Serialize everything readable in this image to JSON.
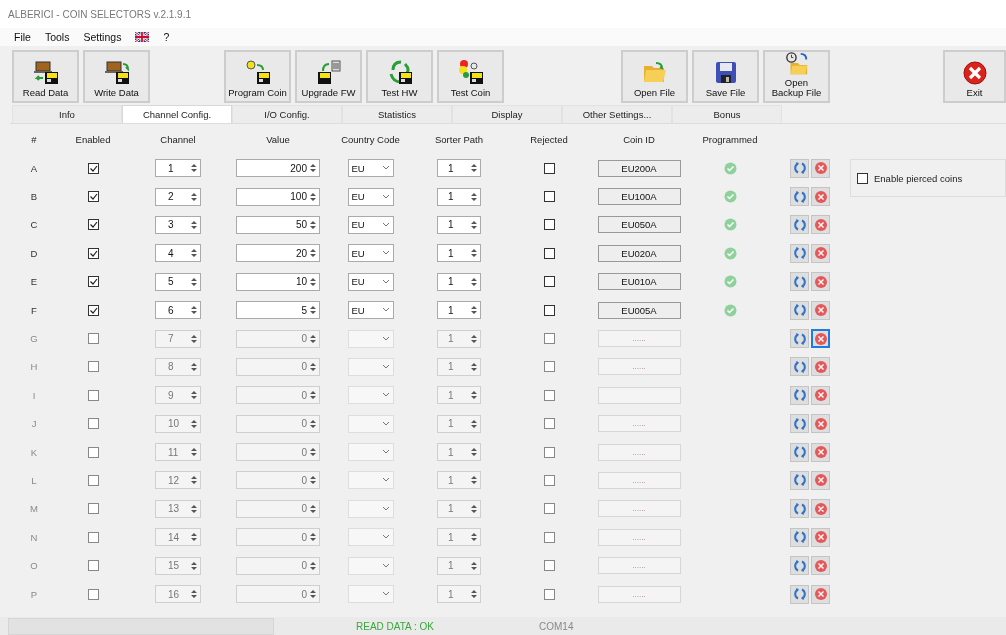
{
  "window": {
    "title": "ALBERICI - COIN SELECTORS v.2.1.9.1"
  },
  "menu": [
    {
      "kind": "text",
      "label": "File"
    },
    {
      "kind": "text",
      "label": "Tools"
    },
    {
      "kind": "text",
      "label": "Settings"
    },
    {
      "kind": "flag"
    },
    {
      "kind": "text",
      "label": "?"
    }
  ],
  "toolbar_groups": [
    [
      {
        "label": "Read Data"
      },
      {
        "label": "Write Data"
      }
    ],
    [
      {
        "label": "Program Coin"
      },
      {
        "label": "Upgrade FW"
      },
      {
        "label": "Test HW"
      },
      {
        "label": "Test Coin"
      }
    ],
    [
      {
        "label": "Open File"
      },
      {
        "label": "Save File"
      },
      {
        "label": "Open\nBackup File"
      }
    ],
    [
      {
        "label": "Exit"
      }
    ]
  ],
  "tabs": [
    {
      "label": "Info",
      "selected": false
    },
    {
      "label": "Channel Config.",
      "selected": true
    },
    {
      "label": "I/O Config.",
      "selected": false
    },
    {
      "label": "Statistics",
      "selected": false
    },
    {
      "label": "Display",
      "selected": false
    },
    {
      "label": "Other Settings...",
      "selected": false
    },
    {
      "label": "Bonus",
      "selected": false
    }
  ],
  "table": {
    "columns": [
      "#",
      "Enabled",
      "Channel",
      "Value",
      "Country Code",
      "Sorter Path",
      "Rejected",
      "Coin ID",
      "Programmed"
    ],
    "rows": [
      {
        "id": "A",
        "enabled": true,
        "channel": "1",
        "value": "200",
        "country": "EU",
        "sorter_path": "1",
        "rejected": false,
        "coin_id": "EU200A",
        "programmed": true,
        "disabled": false,
        "delete_focused": false
      },
      {
        "id": "B",
        "enabled": true,
        "channel": "2",
        "value": "100",
        "country": "EU",
        "sorter_path": "1",
        "rejected": false,
        "coin_id": "EU100A",
        "programmed": true,
        "disabled": false,
        "delete_focused": false
      },
      {
        "id": "C",
        "enabled": true,
        "channel": "3",
        "value": "50",
        "country": "EU",
        "sorter_path": "1",
        "rejected": false,
        "coin_id": "EU050A",
        "programmed": true,
        "disabled": false,
        "delete_focused": false
      },
      {
        "id": "D",
        "enabled": true,
        "channel": "4",
        "value": "20",
        "country": "EU",
        "sorter_path": "1",
        "rejected": false,
        "coin_id": "EU020A",
        "programmed": true,
        "disabled": false,
        "delete_focused": false
      },
      {
        "id": "E",
        "enabled": true,
        "channel": "5",
        "value": "10",
        "country": "EU",
        "sorter_path": "1",
        "rejected": false,
        "coin_id": "EU010A",
        "programmed": true,
        "disabled": false,
        "delete_focused": false
      },
      {
        "id": "F",
        "enabled": true,
        "channel": "6",
        "value": "5",
        "country": "EU",
        "sorter_path": "1",
        "rejected": false,
        "coin_id": "EU005A",
        "programmed": true,
        "disabled": false,
        "delete_focused": false
      },
      {
        "id": "G",
        "enabled": false,
        "channel": "7",
        "value": "0",
        "sorter_path": "1",
        "rejected": false,
        "coin_id": "......",
        "programmed": false,
        "disabled": true,
        "delete_focused": true
      },
      {
        "id": "H",
        "enabled": false,
        "channel": "8",
        "value": "0",
        "sorter_path": "1",
        "rejected": false,
        "coin_id": "......",
        "programmed": false,
        "disabled": true,
        "delete_focused": false
      },
      {
        "id": "I",
        "enabled": false,
        "channel": "9",
        "value": "0",
        "sorter_path": "1",
        "rejected": false,
        "programmed": false,
        "disabled": true,
        "delete_focused": false
      },
      {
        "id": "J",
        "enabled": false,
        "channel": "10",
        "value": "0",
        "sorter_path": "1",
        "rejected": false,
        "coin_id": "......",
        "programmed": false,
        "disabled": true,
        "delete_focused": false
      },
      {
        "id": "K",
        "enabled": false,
        "channel": "11",
        "value": "0",
        "sorter_path": "1",
        "rejected": false,
        "coin_id": "......",
        "programmed": false,
        "disabled": true,
        "delete_focused": false
      },
      {
        "id": "L",
        "enabled": false,
        "channel": "12",
        "value": "0",
        "sorter_path": "1",
        "rejected": false,
        "coin_id": "......",
        "programmed": false,
        "disabled": true,
        "delete_focused": false
      },
      {
        "id": "M",
        "enabled": false,
        "channel": "13",
        "value": "0",
        "sorter_path": "1",
        "rejected": false,
        "coin_id": "......",
        "programmed": false,
        "disabled": true,
        "delete_focused": false
      },
      {
        "id": "N",
        "enabled": false,
        "channel": "14",
        "value": "0",
        "sorter_path": "1",
        "rejected": false,
        "coin_id": "......",
        "programmed": false,
        "disabled": true,
        "delete_focused": false
      },
      {
        "id": "O",
        "enabled": false,
        "channel": "15",
        "value": "0",
        "sorter_path": "1",
        "rejected": false,
        "coin_id": "......",
        "programmed": false,
        "disabled": true,
        "delete_focused": false
      },
      {
        "id": "P",
        "enabled": false,
        "channel": "16",
        "value": "0",
        "sorter_path": "1",
        "rejected": false,
        "coin_id": "......",
        "programmed": false,
        "disabled": true,
        "delete_focused": false
      }
    ]
  },
  "pierced": {
    "label": "Enable pierced coins",
    "checked": false
  },
  "status_bar": {
    "message": "READ DATA : OK",
    "port": "COM14"
  }
}
